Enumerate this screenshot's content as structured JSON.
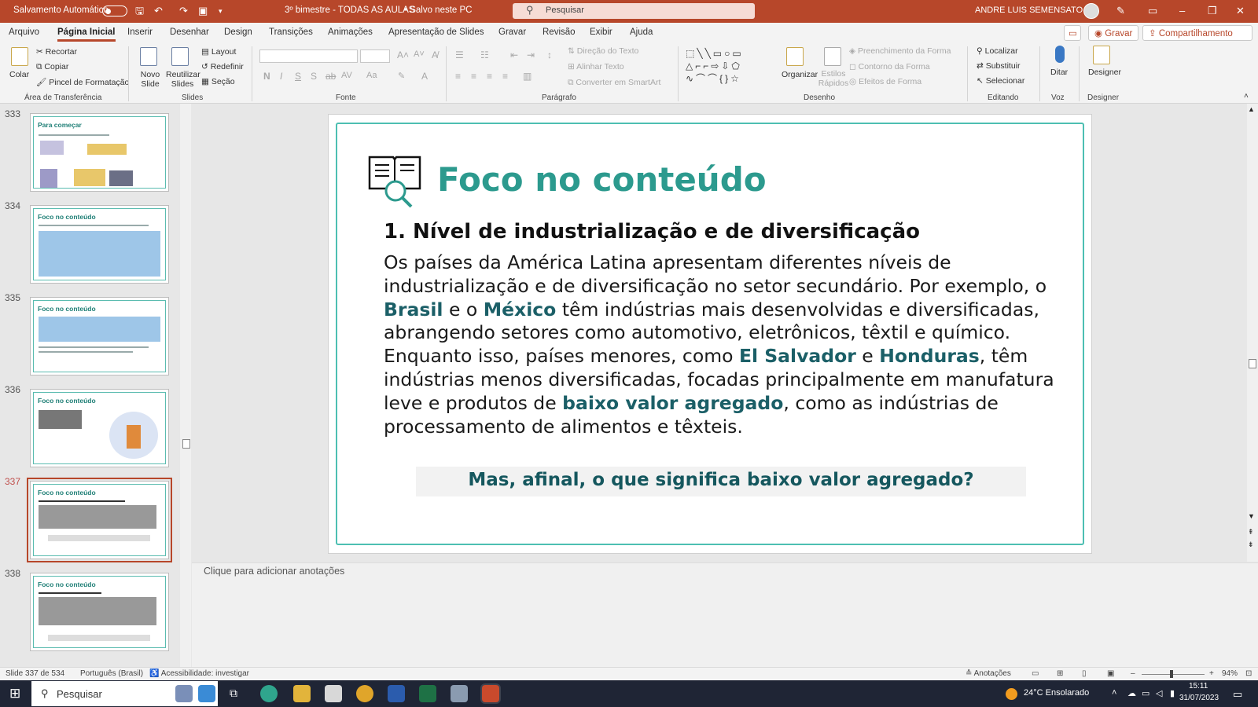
{
  "titlebar": {
    "autosave_label": "Salvamento Automático",
    "doc_title": "3º bimestre - TODAS AS AULAS",
    "saved_status": "• Salvo neste PC",
    "search_placeholder": "Pesquisar",
    "user": "ANDRE LUIS SEMENSATO"
  },
  "menu": [
    "Arquivo",
    "Página Inicial",
    "Inserir",
    "Desenhar",
    "Design",
    "Transições",
    "Animações",
    "Apresentação de Slides",
    "Gravar",
    "Revisão",
    "Exibir",
    "Ajuda"
  ],
  "menu_buttons": {
    "gravar": "Gravar",
    "compartilhar": "Compartilhamento"
  },
  "ribbon": {
    "colar": "Colar",
    "recortar": "Recortar",
    "copiar": "Copiar",
    "pincel": "Pincel de Formatação",
    "grp_area": "Área de Transferência",
    "novo_slide": "Novo Slide",
    "reutilizar": "Reutilizar Slides",
    "layout": "Layout",
    "redefinir": "Redefinir",
    "secao": "Seção",
    "grp_slides": "Slides",
    "grp_fonte": "Fonte",
    "direcao": "Direção do Texto",
    "alinhar": "Alinhar Texto",
    "smartart": "Converter em SmartArt",
    "grp_paragrafo": "Parágrafo",
    "organizar": "Organizar",
    "estilos": "Estilos Rápidos",
    "preenchimento": "Preenchimento da Forma",
    "contorno": "Contorno da Forma",
    "efeitos": "Efeitos de Forma",
    "grp_desenho": "Desenho",
    "localizar": "Localizar",
    "substituir": "Substituir",
    "selecionar": "Selecionar",
    "grp_editando": "Editando",
    "ditar": "Ditar",
    "grp_voz": "Voz",
    "designer": "Designer",
    "grp_designer": "Designer"
  },
  "thumbnails": [
    {
      "num": "333",
      "title": "Para começar"
    },
    {
      "num": "334",
      "title": "Foco no conteúdo"
    },
    {
      "num": "335",
      "title": "Foco no conteúdo"
    },
    {
      "num": "336",
      "title": "Foco no conteúdo"
    },
    {
      "num": "337",
      "title": "Foco no conteúdo"
    },
    {
      "num": "338",
      "title": "Foco no conteúdo"
    }
  ],
  "slide": {
    "title": "Foco no conteúdo",
    "heading": "1. Nível de industrialização e de diversificação",
    "body": {
      "p1": "Os países da América Latina apresentam diferentes níveis de industrialização e de diversificação no setor secundário. Por exemplo, o ",
      "b1": "Brasil",
      "p2": " e o ",
      "b2": "México",
      "p3": " têm indústrias mais desenvolvidas e diversificadas, abrangendo setores como automotivo, eletrônicos, têxtil e químico. Enquanto isso, países menores, como ",
      "b3": "El Salvador",
      "p4": " e ",
      "b4": "Honduras",
      "p5": ", têm indústrias menos diversificadas, focadas principalmente em manufatura leve e produtos de ",
      "b5": "baixo valor agregado",
      "p6": ", como as indústrias de processamento de alimentos e têxteis."
    },
    "question": "Mas, afinal, o que significa baixo valor agregado?"
  },
  "notes_placeholder": "Clique para adicionar anotações",
  "statusbar": {
    "slide_count": "Slide 337 de 534",
    "language": "Português (Brasil)",
    "accessibility": "Acessibilidade: investigar",
    "notes": "Anotações",
    "zoom": "94%"
  },
  "taskbar": {
    "search": "Pesquisar",
    "weather": "24°C  Ensolarado",
    "time": "15:11",
    "date": "31/07/2023"
  },
  "colors": {
    "accent": "#b7472a",
    "teal": "#2c9a8e",
    "dark_teal": "#1b5f67"
  }
}
